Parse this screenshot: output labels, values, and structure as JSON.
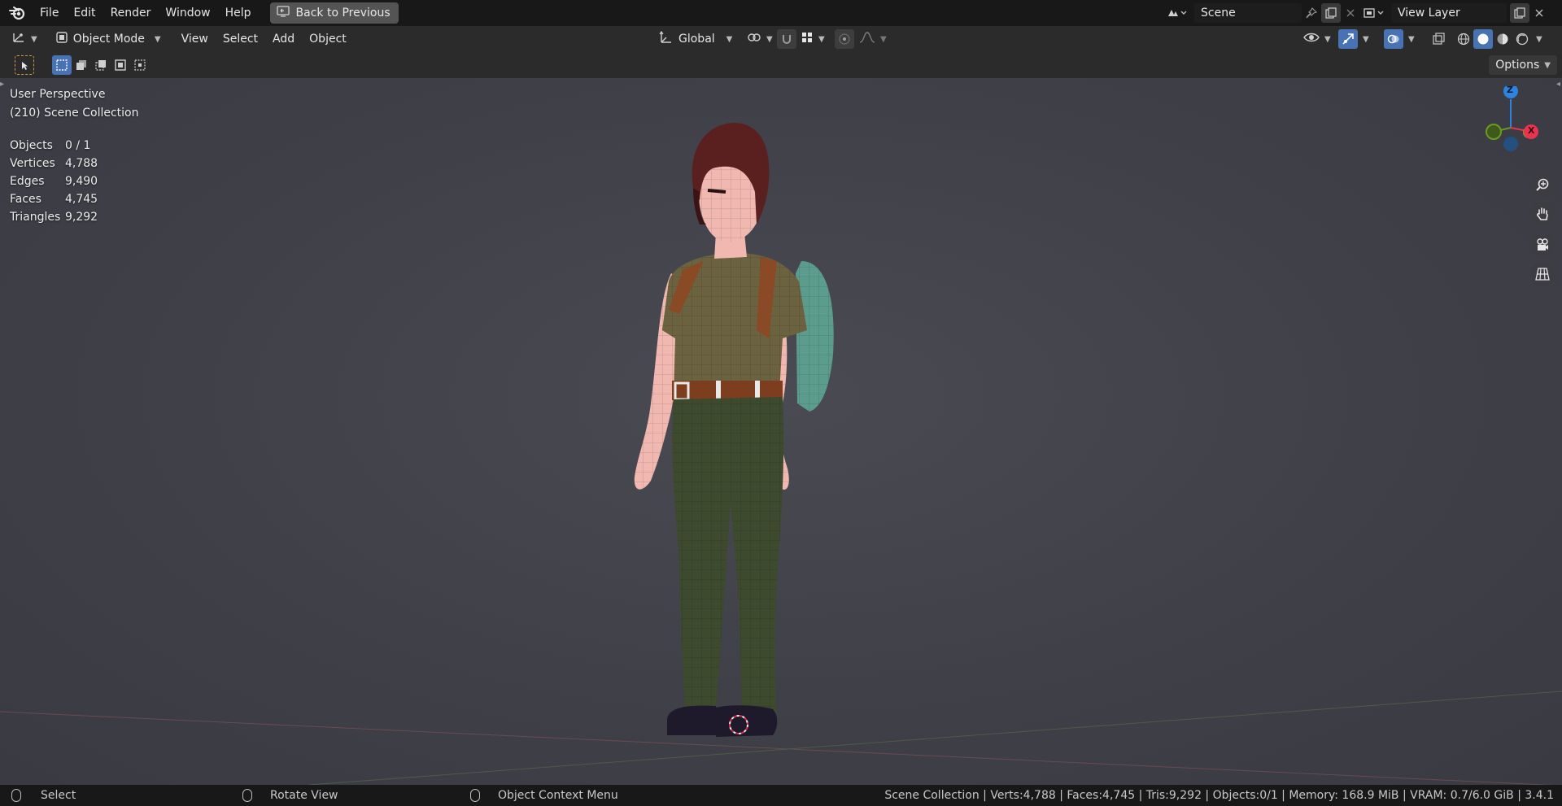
{
  "menu": {
    "items": [
      "File",
      "Edit",
      "Render",
      "Window",
      "Help"
    ],
    "back_button": "Back to Previous"
  },
  "scene": {
    "name": "Scene"
  },
  "view_layer": {
    "name": "View Layer"
  },
  "header": {
    "mode": "Object Mode",
    "menus": [
      "View",
      "Select",
      "Add",
      "Object"
    ],
    "orientation": "Global"
  },
  "toolbar": {
    "options_label": "Options"
  },
  "viewport": {
    "perspective": "User Perspective",
    "collection": "(210) Scene Collection",
    "stats": [
      {
        "label": "Objects",
        "value": "0 / 1"
      },
      {
        "label": "Vertices",
        "value": "4,788"
      },
      {
        "label": "Edges",
        "value": "9,490"
      },
      {
        "label": "Faces",
        "value": "4,745"
      },
      {
        "label": "Triangles",
        "value": "9,292"
      }
    ],
    "gizmo": {
      "z": "Z",
      "x": "X"
    },
    "nav_icons": [
      "zoom-icon",
      "pan-hand-icon",
      "camera-icon",
      "grid-icon"
    ]
  },
  "status": {
    "hints": [
      "Select",
      "Rotate View",
      "Object Context Menu"
    ],
    "info": "Scene Collection | Verts:4,788 | Faces:4,745 | Tris:9,292 | Objects:0/1 | Memory: 168.9 MiB | VRAM: 0.7/6.0 GiB | 3.4.1"
  },
  "colors": {
    "accent": "#4772b3",
    "axis_x": "#e8344e",
    "axis_y": "#6a9a23",
    "axis_z": "#2f83e0"
  }
}
